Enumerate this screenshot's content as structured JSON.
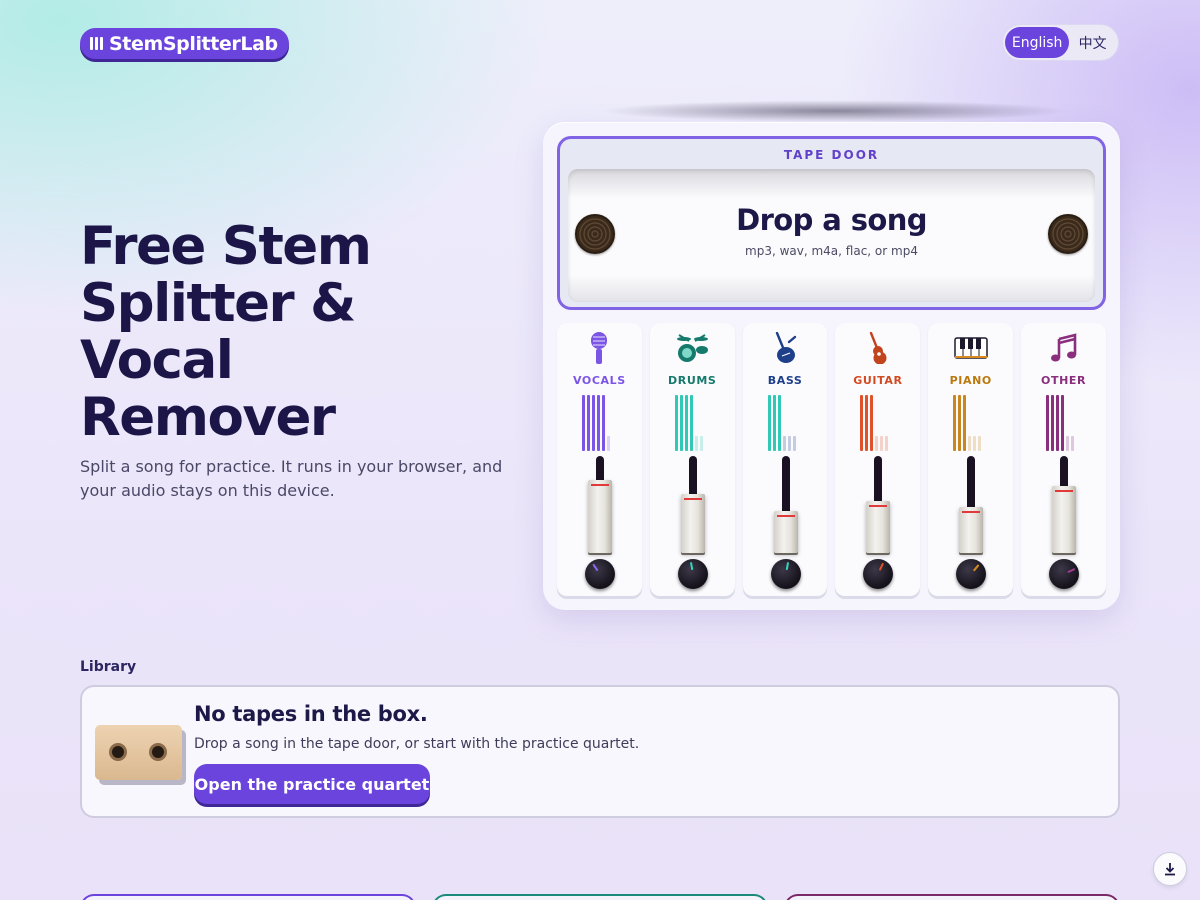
{
  "header": {
    "logo_text": "StemSplitterLab",
    "languages": [
      {
        "label": "English",
        "active": true
      },
      {
        "label": "中文",
        "active": false
      }
    ]
  },
  "hero": {
    "title_lines": [
      "Free Stem",
      "Splitter &",
      "Vocal",
      "Remover"
    ],
    "subtitle": "Split a song for practice. It runs in your browser, and your audio stays on this device."
  },
  "tape_door": {
    "label": "TAPE DOOR",
    "title": "Drop a song",
    "formats": "mp3, wav, m4a, flac, or mp4"
  },
  "channels": [
    {
      "name": "VOCALS",
      "icon": "microphone-icon",
      "color": "#7b55e6",
      "knob_color": "#8b66f0",
      "fader_level": 0.72
    },
    {
      "name": "DRUMS",
      "icon": "drums-icon",
      "color": "#2fc9b5",
      "knob_color": "#33d6c2",
      "fader_level": 0.58
    },
    {
      "name": "BASS",
      "icon": "bass-guitar-icon",
      "color": "#2fc9b5",
      "knob_color": "#33d6c2",
      "fader_level": 0.4
    },
    {
      "name": "GUITAR",
      "icon": "guitar-icon",
      "color": "#e0522a",
      "knob_color": "#e0522a",
      "fader_level": 0.5
    },
    {
      "name": "PIANO",
      "icon": "piano-icon",
      "color": "#c9871e",
      "knob_color": "#d88a1e",
      "fader_level": 0.45
    },
    {
      "name": "OTHER",
      "icon": "music-note-icon",
      "color": "#8a2e7e",
      "knob_color": "#a03a92",
      "fader_level": 0.65
    }
  ],
  "channel_label_colors": [
    "#7b55e6",
    "#157a6c",
    "#1e3f8a",
    "#d24a22",
    "#b9790f",
    "#8a2e7e"
  ],
  "library": {
    "label": "Library",
    "empty_title": "No tapes in the box.",
    "empty_text": "Drop a song in the tape door, or start with the practice quartet.",
    "button_label": "Open the practice quartet"
  },
  "colors": {
    "accent": "#6a44dc",
    "text_dark": "#1b1647"
  },
  "icons": {
    "download": "download-icon"
  }
}
